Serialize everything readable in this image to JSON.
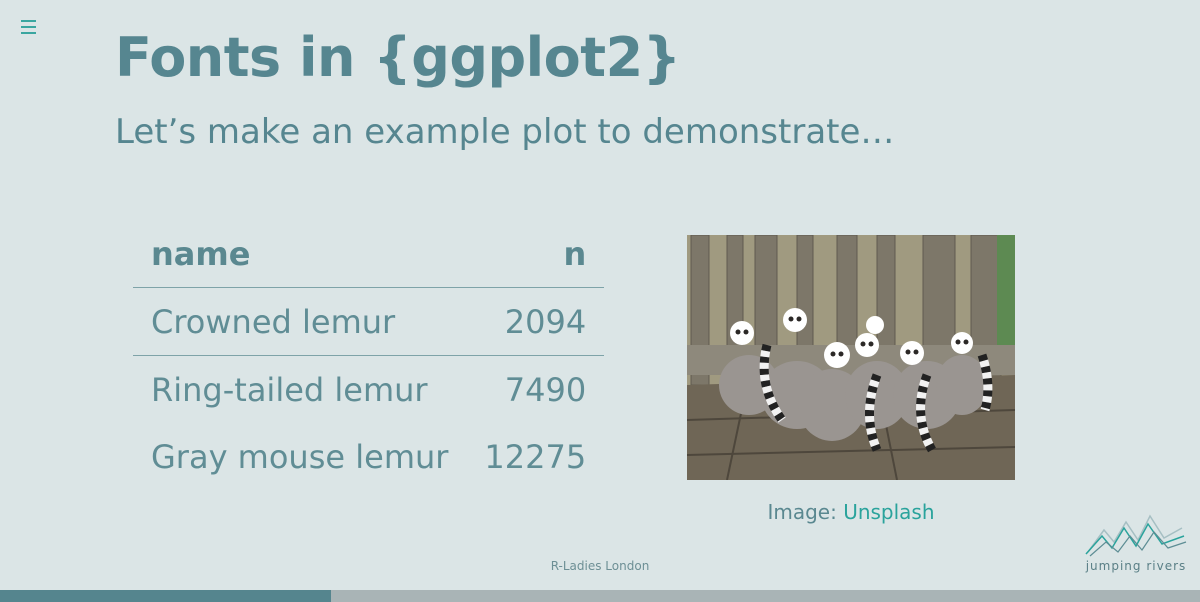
{
  "slide": {
    "title": "Fonts in {ggplot2}",
    "subtitle": "Let’s make an example plot to demonstrate…"
  },
  "table": {
    "headers": {
      "name": "name",
      "n": "n"
    },
    "rows": [
      {
        "name": "Crowned lemur",
        "n": "2094"
      },
      {
        "name": "Ring-tailed lemur",
        "n": "7490"
      },
      {
        "name": "Gray mouse lemur",
        "n": "12275"
      }
    ]
  },
  "image": {
    "caption_prefix": "Image:",
    "caption_link": "Unsplash"
  },
  "footer": {
    "text": "R-Ladies London"
  },
  "logo": {
    "text": "jumping rivers"
  },
  "progress": {
    "fraction": 0.276
  },
  "icons": {
    "menu": "menu-icon"
  },
  "colors": {
    "background": "#dbe5e6",
    "heading": "#568690",
    "accent": "#2aa39c",
    "progress_fill": "#55858e",
    "progress_track": "#a9b4b6"
  }
}
